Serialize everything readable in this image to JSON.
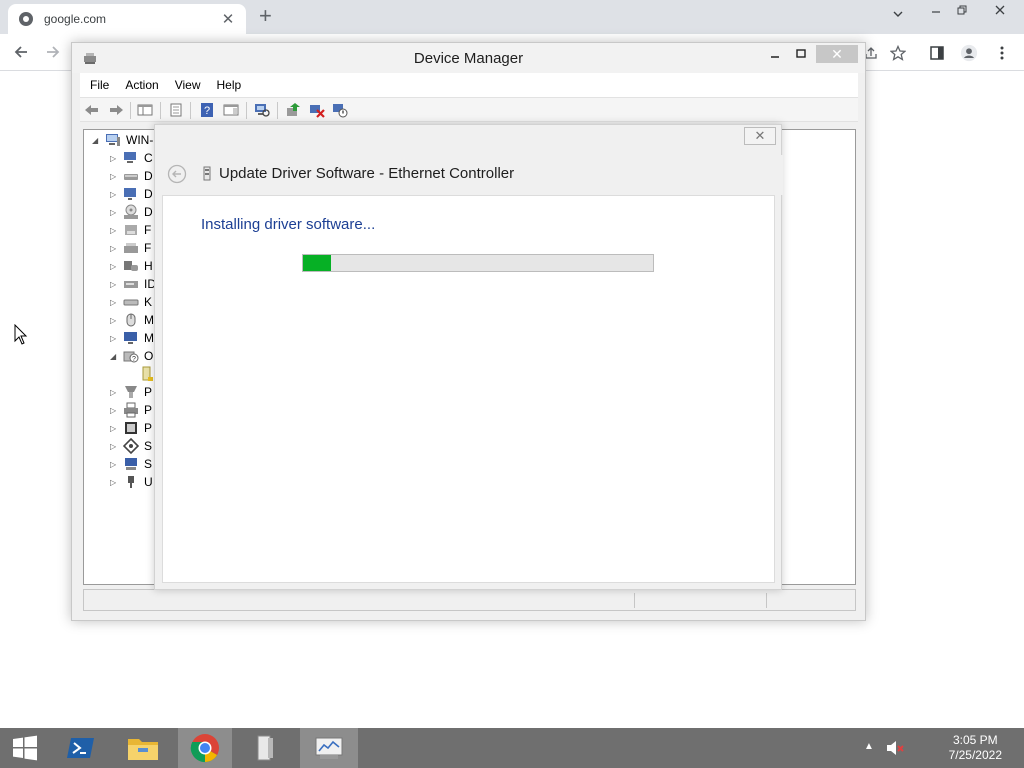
{
  "browser": {
    "tab_title": "google.com",
    "tab_close": "✕",
    "new_tab": "+"
  },
  "device_manager": {
    "title": "Device Manager",
    "menu": [
      "File",
      "Action",
      "View",
      "Help"
    ],
    "tree_root": "WIN-",
    "tree_items": [
      {
        "label": "C",
        "icon": "computer-icon",
        "expanded": false
      },
      {
        "label": "D",
        "icon": "disk-drive-icon",
        "expanded": false
      },
      {
        "label": "D",
        "icon": "display-adapter-icon",
        "expanded": false
      },
      {
        "label": "D",
        "icon": "dvd-drive-icon",
        "expanded": false
      },
      {
        "label": "F",
        "icon": "floppy-icon",
        "expanded": false
      },
      {
        "label": "F",
        "icon": "floppy-controller-icon",
        "expanded": false
      },
      {
        "label": "H",
        "icon": "hid-icon",
        "expanded": false
      },
      {
        "label": "ID",
        "icon": "ide-controller-icon",
        "expanded": false
      },
      {
        "label": "K",
        "icon": "keyboard-icon",
        "expanded": false
      },
      {
        "label": "M",
        "icon": "mouse-icon",
        "expanded": false
      },
      {
        "label": "M",
        "icon": "monitor-icon",
        "expanded": false
      },
      {
        "label": "O",
        "icon": "other-devices-icon",
        "expanded": true
      },
      {
        "label": "",
        "icon": "unknown-device-icon",
        "child": true
      },
      {
        "label": "P",
        "icon": "port-icon",
        "expanded": false
      },
      {
        "label": "P",
        "icon": "printer-icon",
        "expanded": false
      },
      {
        "label": "P",
        "icon": "processor-icon",
        "expanded": false
      },
      {
        "label": "S",
        "icon": "software-device-icon",
        "expanded": false
      },
      {
        "label": "S",
        "icon": "system-devices-icon",
        "expanded": false
      },
      {
        "label": "U",
        "icon": "usb-icon",
        "expanded": false
      }
    ]
  },
  "dialog": {
    "title": "Update Driver Software - Ethernet Controller",
    "status": "Installing driver software...",
    "progress_fraction": 0.08,
    "close": "✕"
  },
  "taskbar": {
    "time": "3:05 PM",
    "date": "7/25/2022"
  },
  "colors": {
    "progress_green": "#06b025",
    "status_text_blue": "#1c3f94",
    "taskbar": "#6f6f6f"
  }
}
